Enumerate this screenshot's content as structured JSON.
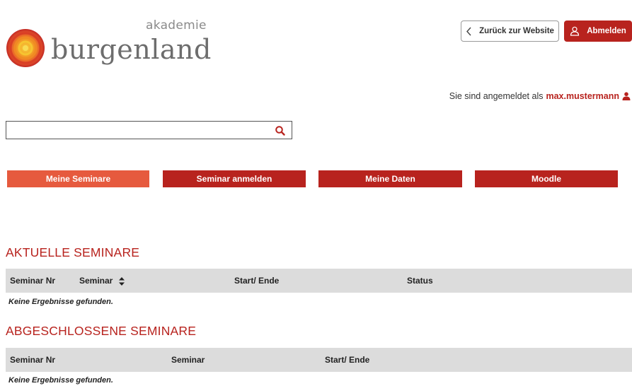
{
  "header": {
    "logo_small": "akademie",
    "logo_big": "burgenland",
    "back_label": "Zurück zur Website",
    "logout_label": "Abmelden"
  },
  "login": {
    "prefix": "Sie sind angemeldet als",
    "username": "max.mustermann"
  },
  "search": {
    "value": "",
    "placeholder": ""
  },
  "nav": {
    "tabs": [
      {
        "label": "Meine Seminare",
        "active": true
      },
      {
        "label": "Seminar anmelden",
        "active": false
      },
      {
        "label": "Meine Daten",
        "active": false
      },
      {
        "label": "Moodle",
        "active": false
      }
    ]
  },
  "current": {
    "title": "AKTUELLE SEMINARE",
    "columns": [
      "Seminar Nr",
      "Seminar",
      "Start/ Ende",
      "Status"
    ],
    "empty": "Keine Ergebnisse gefunden."
  },
  "finished": {
    "title": "ABGESCHLOSSENE SEMINARE",
    "columns": [
      "Seminar Nr",
      "Seminar",
      "Start/ Ende"
    ],
    "empty": "Keine Ergebnisse gefunden."
  },
  "colors": {
    "brand": "#b8231e",
    "active_tab": "#e65a3e",
    "table_header": "#dcdcdc"
  },
  "icons": {
    "logo": "burgenland-sun-logo-icon",
    "back": "chevron-left-icon",
    "logout": "user-outline-icon",
    "user": "user-icon",
    "search": "search-icon",
    "sort": "sort-icon"
  }
}
